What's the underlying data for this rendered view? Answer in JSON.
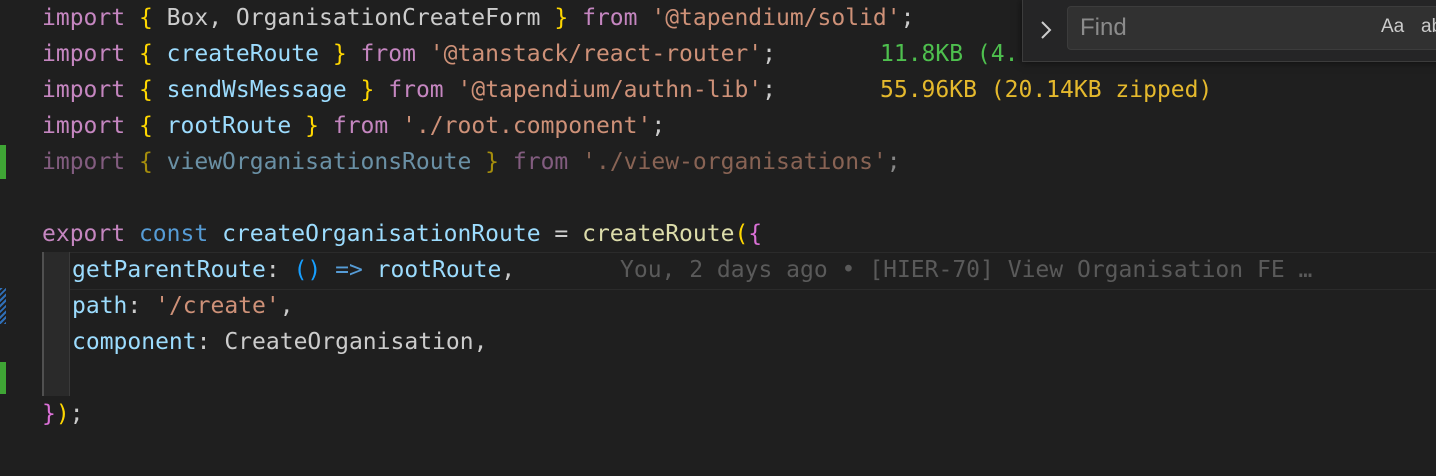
{
  "code": {
    "l1": {
      "kw": "import",
      "ob": "{",
      "names": " Box, OrganisationCreateForm ",
      "cb": "}",
      "from": "from",
      "src": "'@tapendium/solid'",
      "semi": ";"
    },
    "l2": {
      "kw": "import",
      "ob": "{",
      "names": " createRoute ",
      "cb": "}",
      "from": "from",
      "src": "'@tanstack/react-router'",
      "semi": ";",
      "size": "11.8KB (4."
    },
    "l3": {
      "kw": "import",
      "ob": "{",
      "names": " sendWsMessage ",
      "cb": "}",
      "from": "from",
      "src": "'@tapendium/authn-lib'",
      "semi": ";",
      "size": "55.96KB (20.14KB zipped)"
    },
    "l4": {
      "kw": "import",
      "ob": "{",
      "names": " rootRoute ",
      "cb": "}",
      "from": "from",
      "src": "'./root.component'",
      "semi": ";"
    },
    "l5": {
      "kw": "import",
      "ob": "{",
      "names": " viewOrganisationsRoute ",
      "cb": "}",
      "from": "from",
      "src": "'./view-organisations'",
      "semi": ";"
    },
    "l7": {
      "kw": "export",
      "kw2": "const",
      "name": "createOrganisationRoute",
      "eq": " = ",
      "fn": "createRoute",
      "open": "(",
      "ob": "{"
    },
    "l8": {
      "key": "getParentRoute",
      "colon": ": ",
      "parens": "()",
      "arrow": " => ",
      "val": "rootRoute",
      "comma": ",",
      "blame": "You, 2 days ago • [HIER-70] View Organisation FE …"
    },
    "l9": {
      "key": "path",
      "colon": ": ",
      "val": "'/create'",
      "comma": ","
    },
    "l10": {
      "key": "component",
      "colon": ": ",
      "val": "CreateOrganisation",
      "comma": ","
    },
    "l12": {
      "cb": "}",
      "close": ")",
      "semi": ";"
    }
  },
  "find": {
    "placeholder": "Find",
    "match_case": "Aa",
    "whole_word": "ab"
  },
  "colors": {
    "background": "#1f1f1f",
    "keyword_import": "#c586c0",
    "keyword_decl": "#569cd6",
    "string": "#ce9178",
    "function": "#dcdcaa",
    "variable": "#9cdcfe",
    "brace": "#ffd700",
    "git_added": "#3fa535",
    "git_modified": "#2f6fb8"
  }
}
